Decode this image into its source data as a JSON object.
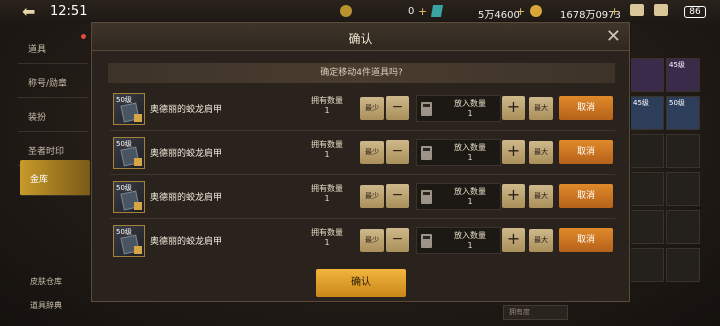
{
  "status": {
    "time": "12:51",
    "currency1": "0",
    "currency2": "5万4600",
    "currency3": "1678万0973",
    "battery": "86"
  },
  "sidebar": {
    "items": [
      {
        "label": "道具"
      },
      {
        "label": "称号/勋章"
      },
      {
        "label": "装扮"
      },
      {
        "label": "圣者时印"
      },
      {
        "label": "金库"
      }
    ],
    "bottom": [
      {
        "label": "皮肤仓库"
      },
      {
        "label": "道具辞典"
      }
    ]
  },
  "right_grid": {
    "badges": [
      "45级",
      "45级",
      "50级"
    ]
  },
  "dialog": {
    "title": "确认",
    "prompt": "确定移动4件道具吗?",
    "confirm_label": "确认",
    "rows": [
      {
        "level": "50级",
        "name": "奥德丽的蛟龙肩甲",
        "own_label": "拥有数量",
        "own_value": "1",
        "min_label": "最少",
        "put_label": "放入数量",
        "put_value": "1",
        "max_label": "最大",
        "cancel_label": "取消"
      },
      {
        "level": "50级",
        "name": "奥德丽的蛟龙肩甲",
        "own_label": "拥有数量",
        "own_value": "1",
        "min_label": "最少",
        "put_label": "放入数量",
        "put_value": "1",
        "max_label": "最大",
        "cancel_label": "取消"
      },
      {
        "level": "50级",
        "name": "奥德丽的蛟龙肩甲",
        "own_label": "拥有数量",
        "own_value": "1",
        "min_label": "最少",
        "put_label": "放入数量",
        "put_value": "1",
        "max_label": "最大",
        "cancel_label": "取消"
      },
      {
        "level": "50级",
        "name": "奥德丽的蛟龙肩甲",
        "own_label": "拥有数量",
        "own_value": "1",
        "min_label": "最少",
        "put_label": "放入数量",
        "put_value": "1",
        "max_label": "最大",
        "cancel_label": "取消"
      }
    ]
  },
  "bottom_dropdown": "拥有度"
}
